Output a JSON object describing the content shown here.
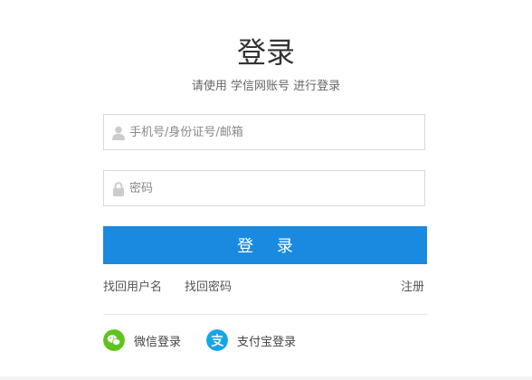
{
  "header": {
    "title": "登录",
    "subtitle": "请使用 学信网账号 进行登录"
  },
  "form": {
    "account": {
      "placeholder": "手机号/身份证号/邮箱",
      "value": "",
      "icon": "user-icon"
    },
    "password": {
      "placeholder": "密码",
      "value": "",
      "icon": "lock-icon"
    },
    "submit_label": "登 录"
  },
  "links": {
    "find_username": "找回用户名",
    "find_password": "找回密码",
    "register": "注册"
  },
  "social": {
    "wechat": {
      "label": "微信登录",
      "icon": "wechat-icon",
      "color": "#5ec41e"
    },
    "alipay": {
      "label": "支付宝登录",
      "icon": "alipay-icon",
      "color": "#1aa4e8"
    }
  },
  "colors": {
    "primary": "#1a8ae0",
    "border": "#d9d9d9",
    "text": "#333333"
  }
}
